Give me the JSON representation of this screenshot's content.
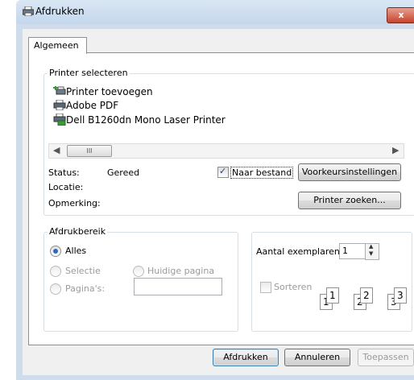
{
  "window": {
    "title": "Afdrukken",
    "close_glyph": "x"
  },
  "tabs": [
    {
      "label": "Algemeen"
    }
  ],
  "printer_group": {
    "title": "Printer selecteren",
    "printers": [
      {
        "label": "Printer toevoegen",
        "icon": "add-printer-icon"
      },
      {
        "label": "Adobe PDF",
        "icon": "printer-icon"
      },
      {
        "label": "Dell B1260dn Mono Laser Printer",
        "icon": "network-printer-icon"
      }
    ],
    "scroll_thumb": "III",
    "status_label": "Status:",
    "status_value": "Gereed",
    "location_label": "Locatie:",
    "comment_label": "Opmerking:",
    "print_to_file_label": "Naar bestand",
    "print_to_file_checked": true,
    "preferences_button": "Voorkeursinstellingen",
    "find_printer_button": "Printer zoeken..."
  },
  "range_group": {
    "title": "Afdrukbereik",
    "all_label": "Alles",
    "selection_label": "Selectie",
    "current_page_label": "Huidige pagina",
    "pages_label": "Pagina's:",
    "pages_value": ""
  },
  "copies": {
    "label": "Aantal exemplaren:",
    "value": "1",
    "collate_label": "Sorteren",
    "collate_checked": false,
    "collate_pages": [
      "1",
      "1",
      "2",
      "2",
      "3",
      "3"
    ]
  },
  "footer": {
    "print_button": "Afdrukken",
    "cancel_button": "Annuleren",
    "apply_button": "Toepassen"
  },
  "colors": {
    "accent": "#3c7fb1",
    "close": "#c7432c",
    "titlebar": "#c5d7ec"
  }
}
